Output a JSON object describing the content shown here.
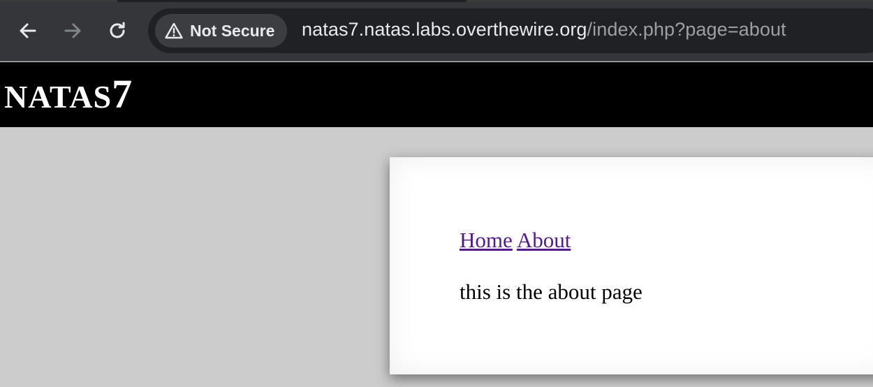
{
  "browser": {
    "security_label": "Not Secure",
    "url_host": "natas7.natas.labs.overthewire.org",
    "url_path": "/index.php?page=about",
    "icons": {
      "back": "arrow-left-icon",
      "forward": "arrow-right-icon",
      "reload": "reload-icon",
      "security": "warning-triangle-icon"
    }
  },
  "page": {
    "title_prefix": "natas",
    "title_number": "7",
    "nav": {
      "home": "Home",
      "about": "About"
    },
    "body_text": "this is the about page"
  },
  "colors": {
    "chrome_bg": "#35363a",
    "omnibox_bg": "#202124",
    "header_bg": "#000000",
    "page_bg": "#cccccc",
    "visited_link": "#551a8b"
  }
}
